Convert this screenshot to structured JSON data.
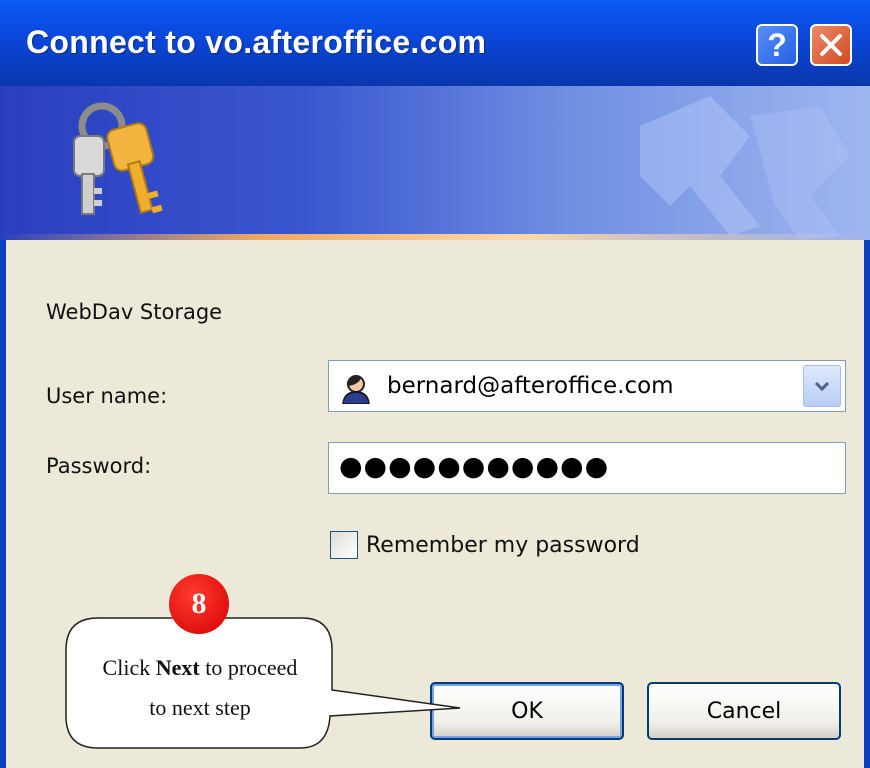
{
  "window": {
    "title": "Connect to vo.afteroffice.com",
    "help_button": "?",
    "close_button": "close"
  },
  "banner": {
    "icon": "keys-icon"
  },
  "form": {
    "site_label": "WebDav Storage",
    "username_label": "User name:",
    "username_value": "bernard@afteroffice.com",
    "password_label": "Password:",
    "password_value": "●●●●●●●●●●●",
    "remember_label": "Remember my password",
    "remember_checked": false
  },
  "buttons": {
    "ok": "OK",
    "cancel": "Cancel"
  },
  "callout": {
    "step_number": "8",
    "text_before": "Click ",
    "text_bold": "Next",
    "text_after": " to proceed",
    "text_line2": "to next step"
  },
  "colors": {
    "titlebar": "#0a5cf5",
    "dialog_bg": "#ece9d8",
    "badge": "#e00000"
  }
}
